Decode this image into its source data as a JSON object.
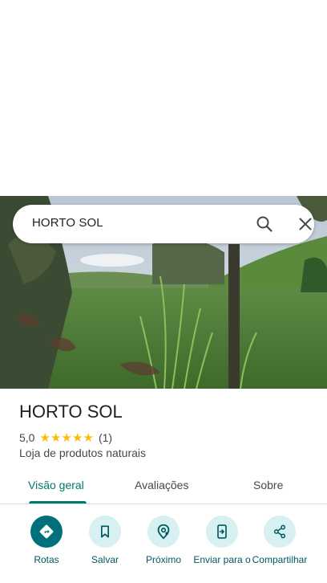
{
  "search": {
    "query": "HORTO SOL"
  },
  "place": {
    "title": "HORTO SOL",
    "rating": "5,0",
    "stars": 5,
    "review_count": "(1)",
    "category": "Loja de produtos naturais"
  },
  "tabs": [
    {
      "label": "Visão geral",
      "active": true
    },
    {
      "label": "Avaliações",
      "active": false
    },
    {
      "label": "Sobre",
      "active": false
    }
  ],
  "actions": [
    {
      "label": "Rotas",
      "icon": "directions-icon"
    },
    {
      "label": "Salvar",
      "icon": "bookmark-icon"
    },
    {
      "label": "Próximo",
      "icon": "nearby-icon"
    },
    {
      "label": "Enviar para o",
      "icon": "send-to-phone-icon"
    },
    {
      "label": "Compartilhar",
      "icon": "share-icon"
    }
  ],
  "colors": {
    "accent": "#00796b",
    "action_primary": "#00707a",
    "action_secondary": "#d7f0f2",
    "star": "#fbbc04"
  }
}
